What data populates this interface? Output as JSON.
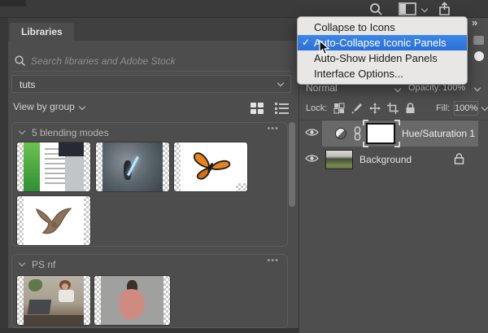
{
  "topbar": {
    "icons": [
      "search-icon",
      "workspace-panel-icon",
      "chevron-down-icon",
      "share-icon"
    ]
  },
  "libraries": {
    "tab_label": "Libraries",
    "search_placeholder": "Search libraries and Adobe Stock",
    "selected_library": "tuts",
    "view_by_label": "View by group",
    "groups": [
      {
        "name": "5 blending modes",
        "items": [
          "green-document",
          "fantasy-warrior-scene",
          "butterfly",
          "dragon"
        ]
      },
      {
        "name": "PS nf",
        "items": [
          "woman-at-desk",
          "woman-dancing"
        ]
      }
    ]
  },
  "panel_menu": {
    "items": [
      {
        "label": "Collapse to Icons",
        "checked": false,
        "highlighted": false
      },
      {
        "label": "Auto-Collapse Iconic Panels",
        "checked": true,
        "highlighted": true
      },
      {
        "label": "Auto-Show Hidden Panels",
        "checked": false,
        "highlighted": false
      },
      {
        "label": "Interface Options...",
        "checked": false,
        "highlighted": false
      }
    ],
    "check_glyph": "✓",
    "highlight_color": "#2d7ce2"
  },
  "layers_panel": {
    "blend_mode": "Normal",
    "opacity_label": "Opacity:",
    "opacity_value": "100%",
    "lock_label": "Lock:",
    "fill_label": "Fill:",
    "fill_value": "100%",
    "layers": [
      {
        "name": "Hue/Saturation 1",
        "type": "adjustment",
        "selected": true
      },
      {
        "name": "Background",
        "type": "image",
        "locked": true
      }
    ],
    "dock_collapse_glyph": "»"
  },
  "icons": {
    "more_glyph": "•••"
  }
}
